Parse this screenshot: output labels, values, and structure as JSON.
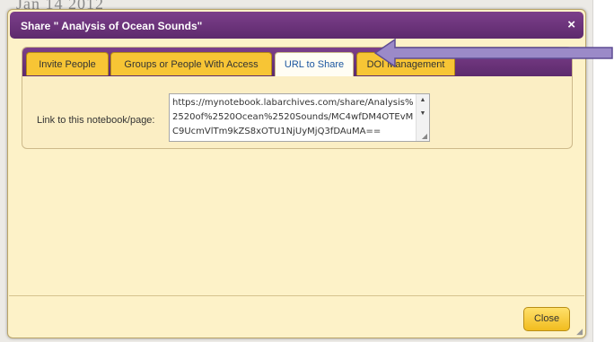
{
  "background": {
    "ghost_text": "Jan 14 2012"
  },
  "dialog": {
    "title": "Share \" Analysis of Ocean Sounds\"",
    "close_glyph": "×",
    "tabs": [
      {
        "label": "Invite People",
        "active": false
      },
      {
        "label": "Groups or People With Access",
        "active": false
      },
      {
        "label": "URL to Share",
        "active": true
      },
      {
        "label": "DOI Management",
        "active": false
      }
    ],
    "url_field": {
      "label": "Link to this notebook/page:",
      "value": "https://mynotebook.labarchives.com/share/Analysis%2520of%2520Ocean%2520Sounds/MC4wfDM4OTEvMC9UcmVlTm9kZS8xOTU1NjUyMjQ3fDAuMA=="
    },
    "close_button_label": "Close"
  },
  "annotation": {
    "arrow_color": "#9b8ac8"
  },
  "colors": {
    "title_bar": "#6a3279",
    "tab_inactive": "#f7c535",
    "tab_active": "#fffdf4",
    "panel_background": "#fdf2c8"
  }
}
